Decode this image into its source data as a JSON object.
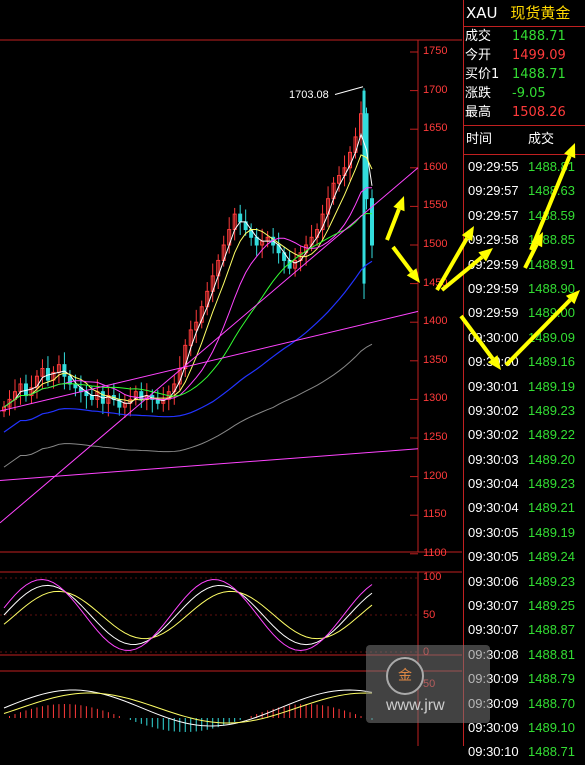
{
  "header": {
    "symbol": "XAU",
    "name": "现货黄金"
  },
  "quote": [
    {
      "label": "成交",
      "value": "1488.71",
      "color": "#33dd33"
    },
    {
      "label": "今开",
      "value": "1499.09",
      "color": "#ff3b3b"
    },
    {
      "label": "买价1",
      "value": "1488.71",
      "color": "#33dd33"
    },
    {
      "label": "涨跌",
      "value": "-9.05",
      "color": "#33dd33"
    },
    {
      "label": "最高",
      "value": "1508.26",
      "color": "#ff3b3b"
    }
  ],
  "ticks_header": {
    "time": "时间",
    "price": "成交"
  },
  "ticks": [
    {
      "time": "09:29:55",
      "price": "1488.81"
    },
    {
      "time": "09:29:57",
      "price": "1488.63"
    },
    {
      "time": "09:29:57",
      "price": "1488.59"
    },
    {
      "time": "09:29:58",
      "price": "1488.85"
    },
    {
      "time": "09:29:59",
      "price": "1488.91"
    },
    {
      "time": "09:29:59",
      "price": "1488.90"
    },
    {
      "time": "09:29:59",
      "price": "1489.00"
    },
    {
      "time": "09:30:00",
      "price": "1489.09"
    },
    {
      "time": "09:30:00",
      "price": "1489.16"
    },
    {
      "time": "09:30:01",
      "price": "1489.19"
    },
    {
      "time": "09:30:02",
      "price": "1489.23"
    },
    {
      "time": "09:30:02",
      "price": "1489.22"
    },
    {
      "time": "09:30:03",
      "price": "1489.20"
    },
    {
      "time": "09:30:04",
      "price": "1489.23"
    },
    {
      "time": "09:30:04",
      "price": "1489.21"
    },
    {
      "time": "09:30:05",
      "price": "1489.19"
    },
    {
      "time": "09:30:05",
      "price": "1489.24"
    },
    {
      "time": "09:30:06",
      "price": "1489.23"
    },
    {
      "time": "09:30:07",
      "price": "1489.25"
    },
    {
      "time": "09:30:07",
      "price": "1488.87"
    },
    {
      "time": "09:30:08",
      "price": "1488.81"
    },
    {
      "time": "09:30:09",
      "price": "1488.79"
    },
    {
      "time": "09:30:09",
      "price": "1488.70"
    },
    {
      "time": "09:30:09",
      "price": "1489.10"
    },
    {
      "time": "09:30:10",
      "price": "1488.71"
    }
  ],
  "chart": {
    "price_axis": [
      "1750",
      "1700",
      "1650",
      "1600",
      "1550",
      "1500",
      "1450",
      "1400",
      "1350",
      "1300",
      "1250",
      "1200",
      "1150",
      "1100"
    ],
    "peak_label": "1703.08",
    "indicator1_axis": [
      "100",
      "50",
      "0"
    ],
    "indicator2_axis": [
      "50"
    ],
    "colors": {
      "up": "#ff3b3b",
      "down": "#33dddd",
      "grid": "#c02020",
      "ma_white": "#ffffff",
      "ma_yellow": "#ffff66",
      "ma_magenta": "#ff44ff",
      "ma_green": "#33ff33",
      "ma_blue": "#2233ff",
      "ma_gray": "#888888",
      "arrow": "#ffff00"
    }
  },
  "watermark": {
    "url": "www.jrw"
  }
}
